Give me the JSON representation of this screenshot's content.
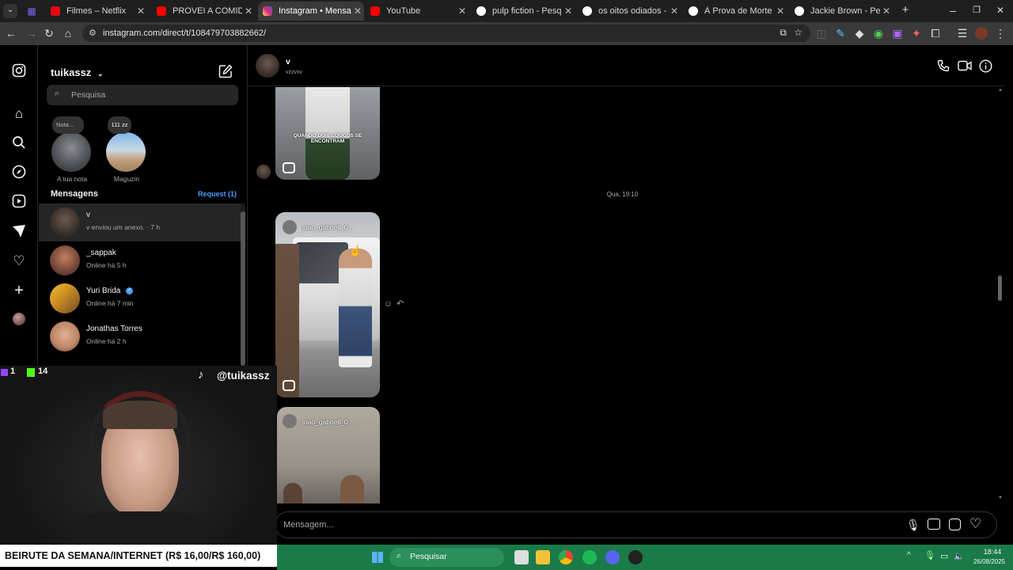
{
  "browser": {
    "tabs": [
      {
        "title": "Filmes – Netflix",
        "color": "#e50914"
      },
      {
        "title": "PROVEI A COMIDA MAIS",
        "color": "#ff0000"
      },
      {
        "title": "Instagram • Mensagens",
        "color": "#d62976",
        "active": true
      },
      {
        "title": "YouTube",
        "color": "#ff0000"
      },
      {
        "title": "pulp fiction - Pesquisa G",
        "color": "#4285f4"
      },
      {
        "title": "os oitos odiados - Pesqu",
        "color": "#4285f4"
      },
      {
        "title": "À Prova de Morte - Pesq",
        "color": "#4285f4"
      },
      {
        "title": "Jackie Brown - Pesquisa",
        "color": "#4285f4"
      }
    ],
    "url": "instagram.com/direct/t/108479703882662/",
    "new_tab": "+"
  },
  "sidebar": {
    "username": "tuikassz",
    "search_placeholder": "Pesquisa",
    "notes": [
      {
        "bubble": "Nota...",
        "label": "A tua nota"
      },
      {
        "bubble": "111 zz",
        "label": "Maguzin"
      }
    ],
    "messages_heading": "Mensagens",
    "request_label": "Request (1)",
    "conversations": [
      {
        "name": "v",
        "sub": "v enviou um anexo. · 7 h",
        "selected": true
      },
      {
        "name": "_sappak",
        "sub": "Online há 5 h"
      },
      {
        "name": "Yuri Brida",
        "sub": "Online há 7 min",
        "verified": true
      },
      {
        "name": "Jonathas Torres",
        "sub": "Online há 2 h"
      }
    ]
  },
  "chat": {
    "contact_name": "v",
    "contact_handle": "vzzvxv",
    "caption_text": "QUANDO DOIS LOUCOS SE ENCONTRAM",
    "timestamp": "Qua, 19:10",
    "reel_author_1": "joao_gabriell_0...",
    "reel_author_2": "joao_gabriell_0...",
    "message_placeholder": "Mensagem..."
  },
  "overlay": {
    "twitch_count": "1",
    "kick_count": "14",
    "tiktok_handle": "@tuikassz",
    "ticker": "BEIRUTE DA SEMANA/INTERNET (R$ 16,00/R$ 160,00)"
  },
  "taskbar": {
    "search_label": "Pesquisar",
    "time": "18:44",
    "date": "26/08/2025",
    "colors": {
      "bar": "#1a7a48"
    }
  },
  "colors": {
    "accent_blue": "#4a9eff",
    "text_secondary": "#a8a8a8"
  }
}
